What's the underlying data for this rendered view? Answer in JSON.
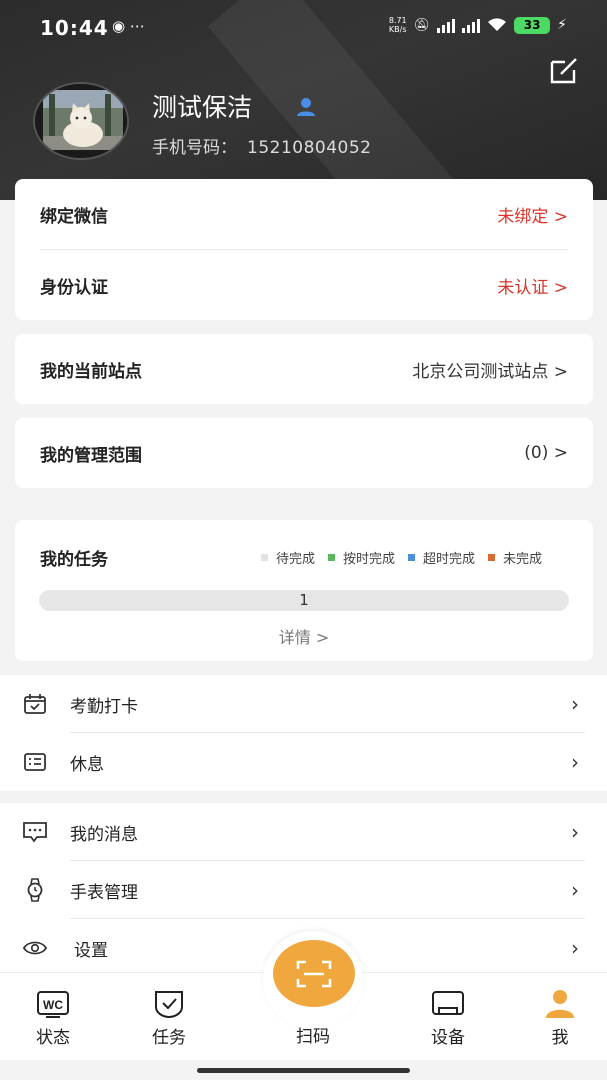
{
  "status_bar": {
    "time": "10:44",
    "extra": "⋯",
    "net_speed_top": "8.71",
    "net_speed_bottom": "KB/s",
    "sig1": "5G",
    "sig2": "5G",
    "battery": "33"
  },
  "profile": {
    "name": "测试保洁",
    "phone_label": "手机号码：",
    "phone_number": "15210804052"
  },
  "account_card": {
    "wechat_label": "绑定微信",
    "wechat_value": "未绑定 >",
    "identity_label": "身份认证",
    "identity_value": "未认证 >"
  },
  "site_card": {
    "label": "我的当前站点",
    "value": "北京公司测试站点 >"
  },
  "scope_card": {
    "label": "我的管理范围",
    "value": "(0) >"
  },
  "tasks": {
    "title": "我的任务",
    "legend": [
      {
        "label": "待完成",
        "color": "#e3e3e3"
      },
      {
        "label": "按时完成",
        "color": "#5cb85c"
      },
      {
        "label": "超时完成",
        "color": "#4a90d9"
      },
      {
        "label": "未完成",
        "color": "#d66b2e"
      }
    ],
    "bar_value": "1",
    "pending_fraction": 1.0,
    "detail": "详情 >"
  },
  "menu_group1": [
    {
      "label": "考勤打卡",
      "icon": "calendar-check-icon"
    },
    {
      "label": "休息",
      "icon": "id-card-icon"
    }
  ],
  "menu_group2": [
    {
      "label": "我的消息",
      "icon": "message-icon"
    },
    {
      "label": "手表管理",
      "icon": "watch-icon"
    },
    {
      "label": "设置",
      "icon": "eye-settings-icon"
    }
  ],
  "tabbar": {
    "status": "状态",
    "status_icon_text": "WC",
    "tasks": "任务",
    "scan": "扫码",
    "devices": "设备",
    "me": "我"
  },
  "colors": {
    "accent": "#efa73e",
    "warning_text": "#d9352b",
    "header_bg": "#2f2f2f"
  }
}
